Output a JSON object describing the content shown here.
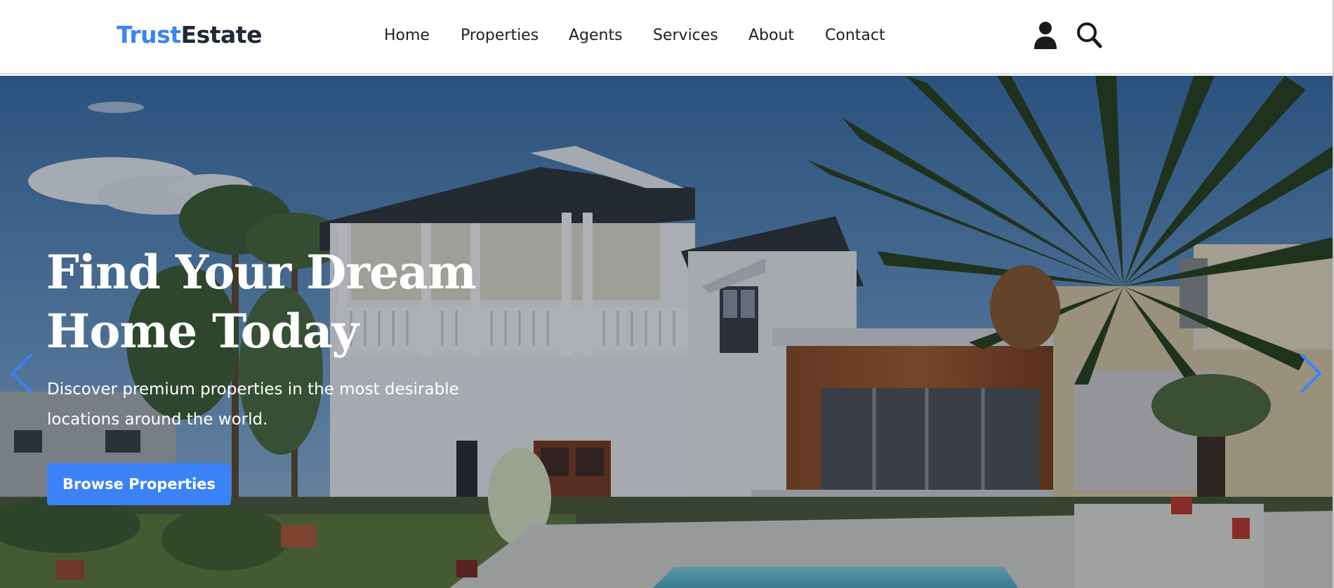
{
  "header": {
    "logo": {
      "part1": "Trust",
      "part2": "Estate"
    },
    "nav": [
      "Home",
      "Properties",
      "Agents",
      "Services",
      "About",
      "Contact"
    ],
    "icons": {
      "account": "user-icon",
      "search": "search-icon"
    }
  },
  "hero": {
    "title_line1": "Find Your Dream",
    "title_line2": "Home Today",
    "subtitle_line1": "Discover premium properties in the most desirable",
    "subtitle_line2": "locations around the world.",
    "cta_label": "Browse Properties",
    "prev_icon": "chevron-left-icon",
    "next_icon": "chevron-right-icon"
  },
  "colors": {
    "accent": "#3b82f6",
    "logo_dark": "#1f2937",
    "nav_text": "#1f1f1f"
  }
}
